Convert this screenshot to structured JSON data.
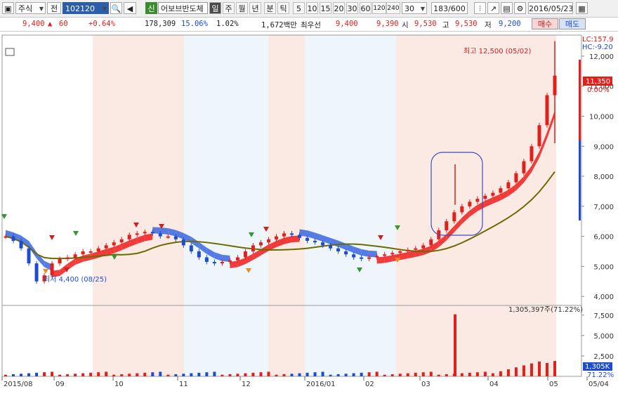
{
  "toolbar": {
    "market_select": "주식",
    "type_label": "전",
    "stock_code": "102120",
    "new_badge": "신",
    "stock_name": "어보브반도체",
    "periods": [
      "일",
      "주",
      "월",
      "년",
      "분",
      "틱"
    ],
    "selected_period": "일",
    "intervals": [
      "5",
      "10",
      "15",
      "20",
      "30",
      "60",
      "120",
      "240"
    ],
    "interval_select": "30",
    "page_count": "183/600",
    "date": "2016/05/23"
  },
  "info_bar": {
    "price": "9,400",
    "change_arrow": "▲",
    "change": "60",
    "change_pct": "+0.64%",
    "volume": "178,309",
    "turnover_pct": "15.06%",
    "ratio_pct": "1.02%",
    "trade_value": "1,672백만",
    "best_label": "최우선",
    "ask": "9,400",
    "bid": "9,390",
    "open_label": "시",
    "open": "9,530",
    "high_label": "고",
    "high": "9,530",
    "low_label": "저",
    "low": "9,200",
    "buy_button": "매수",
    "sell_button": "매도"
  },
  "chart_data": {
    "type": "candlestick",
    "price_axis": {
      "ylim": [
        3700,
        12700
      ],
      "ticks": [
        4000,
        5000,
        6000,
        7000,
        8000,
        9000,
        10000,
        11000,
        12000
      ],
      "tick_labels": [
        "4,000",
        "5,000",
        "6,000",
        "7,000",
        "8,000",
        "9,000",
        "10,000",
        "11,000",
        "12,000"
      ]
    },
    "volume_axis": {
      "ylim": [
        0,
        8000
      ],
      "ticks": [
        2500,
        5000,
        7500
      ],
      "tick_labels": [
        "2,500",
        "5,000",
        "7,500"
      ]
    },
    "x_labels": [
      "2015/08",
      "09",
      "10",
      "11",
      "12",
      "2016/01",
      "02",
      "03",
      "04",
      "05",
      "05/04"
    ],
    "annotations": {
      "high": "최고 12,500 (05/02)",
      "low": "최저 4,400 (08/25)",
      "lc": "LC:157.9",
      "hc": "HC:-9.20",
      "current_price": "11,350",
      "current_pct": "0.00%",
      "volume_info": "1,305,397주(71.22%)",
      "volume_current": "1,305K",
      "volume_pct": "71.22%"
    },
    "series": [
      {
        "name": "close",
        "values": [
          6000,
          5850,
          5600,
          5100,
          4500,
          4700,
          5100,
          5250,
          5300,
          5400,
          5500,
          5500,
          5600,
          5700,
          5800,
          5900,
          6050,
          6100,
          6150,
          6100,
          6000,
          6000,
          5900,
          5700,
          5500,
          5300,
          5150,
          5100,
          5150,
          5200,
          5300,
          5500,
          5700,
          5800,
          5900,
          6000,
          6100,
          6050,
          5950,
          5850,
          5800,
          5700,
          5600,
          5500,
          5400,
          5300,
          5250,
          5300,
          5350,
          5400,
          5450,
          5500,
          5550,
          5600,
          5700,
          5900,
          6200,
          6500,
          6800,
          7000,
          7150,
          7250,
          7350,
          7450,
          7600,
          7800,
          8100,
          8500,
          9000,
          9700,
          10700,
          11350
        ]
      }
    ]
  }
}
